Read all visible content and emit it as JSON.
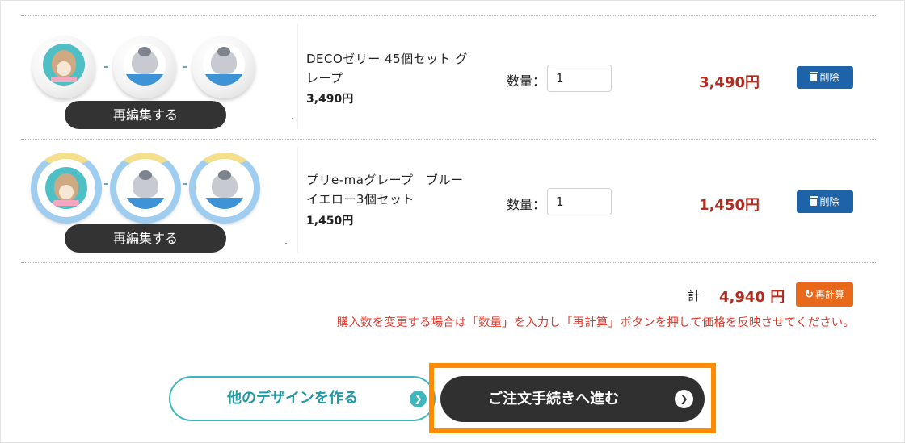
{
  "cart": {
    "items": [
      {
        "name": "DECOゼリー 45個セット グレープ",
        "unit_price": "3,490円",
        "quantity_label": "数量：",
        "quantity": "1",
        "line_total": "3,490円",
        "reedit_label": "再編集する",
        "delete_label": "削除",
        "thumbnail_style": "jelly-cup"
      },
      {
        "name": "プリe-maグレープ　ブルーイエロー3個セット",
        "unit_price": "1,450円",
        "quantity_label": "数量：",
        "quantity": "1",
        "line_total": "1,450円",
        "reedit_label": "再編集する",
        "delete_label": "削除",
        "thumbnail_style": "purin-cup"
      }
    ],
    "summary": {
      "total_label": "計",
      "total_value": "4,940 円",
      "recalc_label": "再計算"
    },
    "notice": "購入数を変更する場合は「数量」を入力し「再計算」ボタンを押して価格を反映させてください。"
  },
  "actions": {
    "other_design_label": "他のデザインを作る",
    "checkout_label": "ご注文手続きへ進む"
  },
  "icons": {
    "delete": "trash-icon",
    "recalc": "refresh-icon",
    "arrow": "chevron-right-circle-icon"
  },
  "colors": {
    "price_red": "#b52a1c",
    "notice_red": "#e23a2b",
    "delete_blue": "#1e63a8",
    "recalc_orange": "#e8691c",
    "teal": "#3bb7bd",
    "highlight_orange": "#ff8c00"
  }
}
